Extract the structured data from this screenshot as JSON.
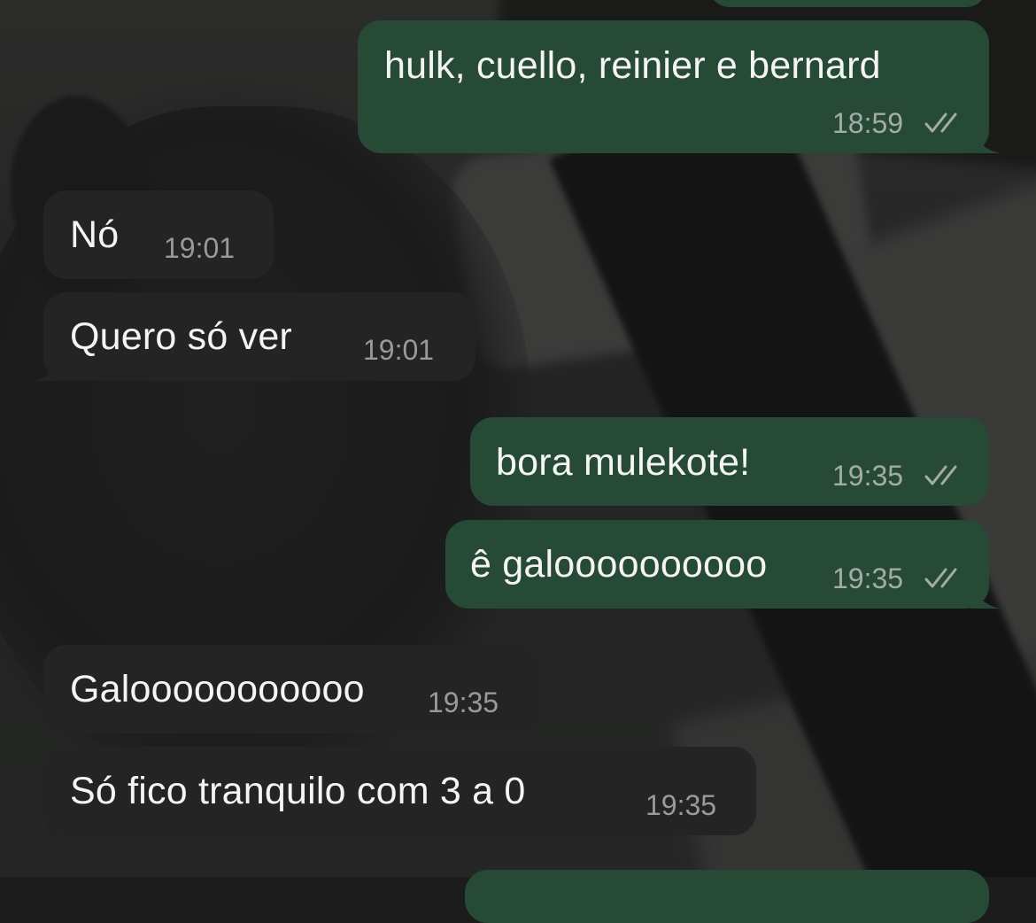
{
  "colors": {
    "outgoing_bubble": "#264a36",
    "incoming_bubble": "#232423",
    "message_text": "#f4f4f4",
    "outgoing_time": "#a4aca7",
    "incoming_time": "#9a9a9a"
  },
  "messages": [
    {
      "direction": "outgoing",
      "text": "hulk, cuello, reinier e bernard",
      "time": "18:59",
      "status_icon": "double-check-icon"
    },
    {
      "direction": "incoming",
      "text": "Nó",
      "time": "19:01"
    },
    {
      "direction": "incoming",
      "text": "Quero só ver",
      "time": "19:01"
    },
    {
      "direction": "outgoing",
      "text": "bora mulekote!",
      "time": "19:35",
      "status_icon": "double-check-icon"
    },
    {
      "direction": "outgoing",
      "text": "ê galoooooooooo",
      "time": "19:35",
      "status_icon": "double-check-icon"
    },
    {
      "direction": "incoming",
      "text": "Galooooooooooo",
      "time": "19:35"
    },
    {
      "direction": "incoming",
      "text": "Só fico tranquilo com 3 a 0",
      "time": "19:35"
    }
  ]
}
